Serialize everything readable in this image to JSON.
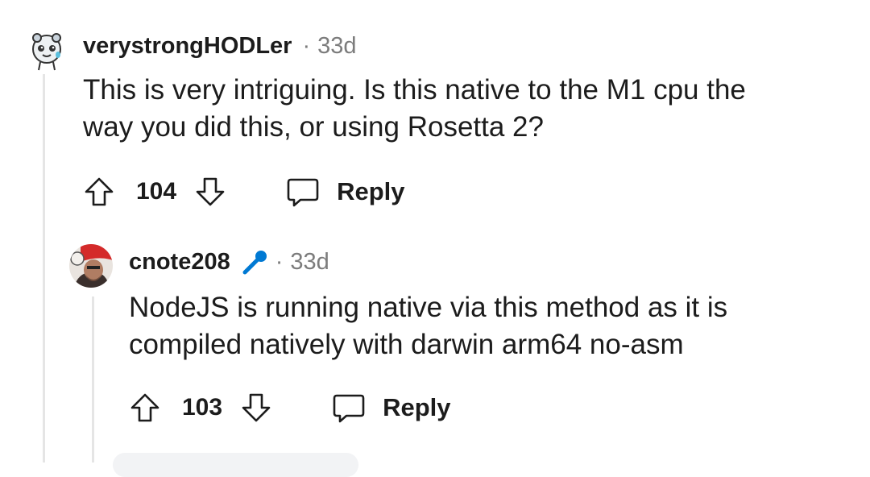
{
  "comments": [
    {
      "username": "verystrongHODLer",
      "separator": "·",
      "age": "33d",
      "body_line1": "This is very intriguing. Is this native to the M1 cpu the",
      "body_line2": "way you did this, or using Rosetta 2?",
      "votes": "104",
      "reply_label": "Reply",
      "avatar_icon": "snoo-avatar-icon"
    },
    {
      "username": "cnote208",
      "flair_icon": "microphone-icon",
      "separator": "·",
      "age": "33d",
      "body_line1": "NodeJS is running native via this method as it is",
      "body_line2": "compiled natively with darwin arm64 no-asm",
      "votes": "103",
      "reply_label": "Reply",
      "avatar_icon": "user-photo-avatar"
    }
  ],
  "colors": {
    "text": "#1c1c1c",
    "meta": "#7c7c7c",
    "thread_line": "#e5e5e5",
    "flair_icon": "#0079d3"
  }
}
